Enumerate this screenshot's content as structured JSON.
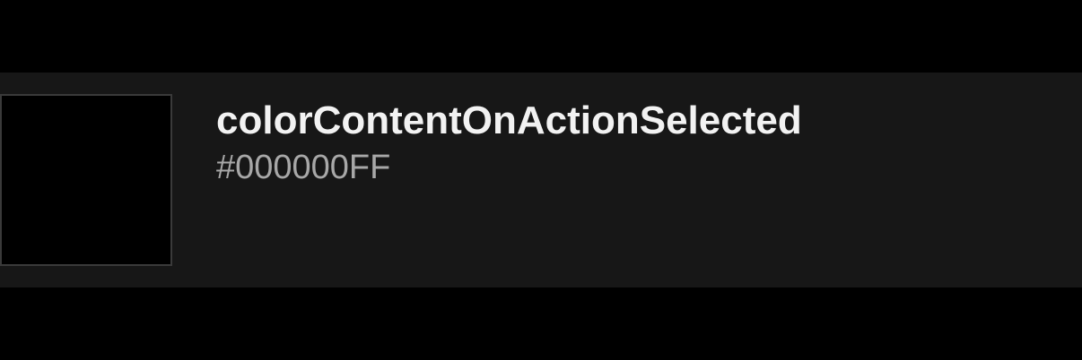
{
  "color_token": {
    "name": "colorContentOnActionSelected",
    "hex": "#000000FF",
    "swatch_color": "#000000"
  },
  "colors": {
    "background": "#000000",
    "row_background": "#171717",
    "swatch_border": "#3a3a3a",
    "name_text": "#f2f2f2",
    "hex_text": "#a8a8a8"
  }
}
